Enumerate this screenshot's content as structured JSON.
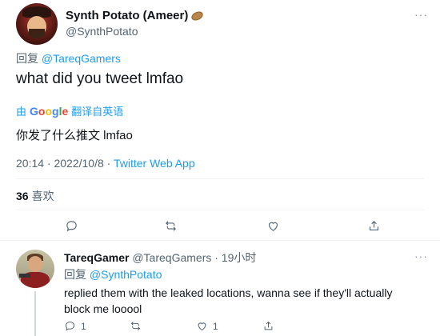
{
  "main_tweet": {
    "display_name": "Synth Potato (Ameer)",
    "name_emoji": "potato-icon",
    "handle": "@SynthPotato",
    "more": "···",
    "reply_prefix": "回复",
    "reply_mention": "@TareqGamers",
    "text": "what did you tweet lmfao",
    "translate": {
      "by": "由",
      "google": [
        "G",
        "o",
        "o",
        "g",
        "l",
        "e"
      ],
      "label": "翻译自英语"
    },
    "translated_text": "你发了什么推文 lmfao",
    "time": "20:14 · 2022/10/8 · ",
    "source": "Twitter Web App",
    "likes_count": "36",
    "likes_label": "喜欢"
  },
  "reply_tweet": {
    "display_name": "TareqGamer",
    "handle_time": "@TareqGamers · 19小时",
    "more": "···",
    "reply_prefix": "回复",
    "reply_mention": "@SynthPotato",
    "text": "replied them with the leaked locations, wanna see if they'll actually block me looool",
    "reply_count": "1",
    "retweet_count": "",
    "like_count": "1"
  },
  "colors": {
    "accent": "#1d9bf0",
    "secondary_text": "#536471",
    "primary_text": "#0f1419"
  }
}
